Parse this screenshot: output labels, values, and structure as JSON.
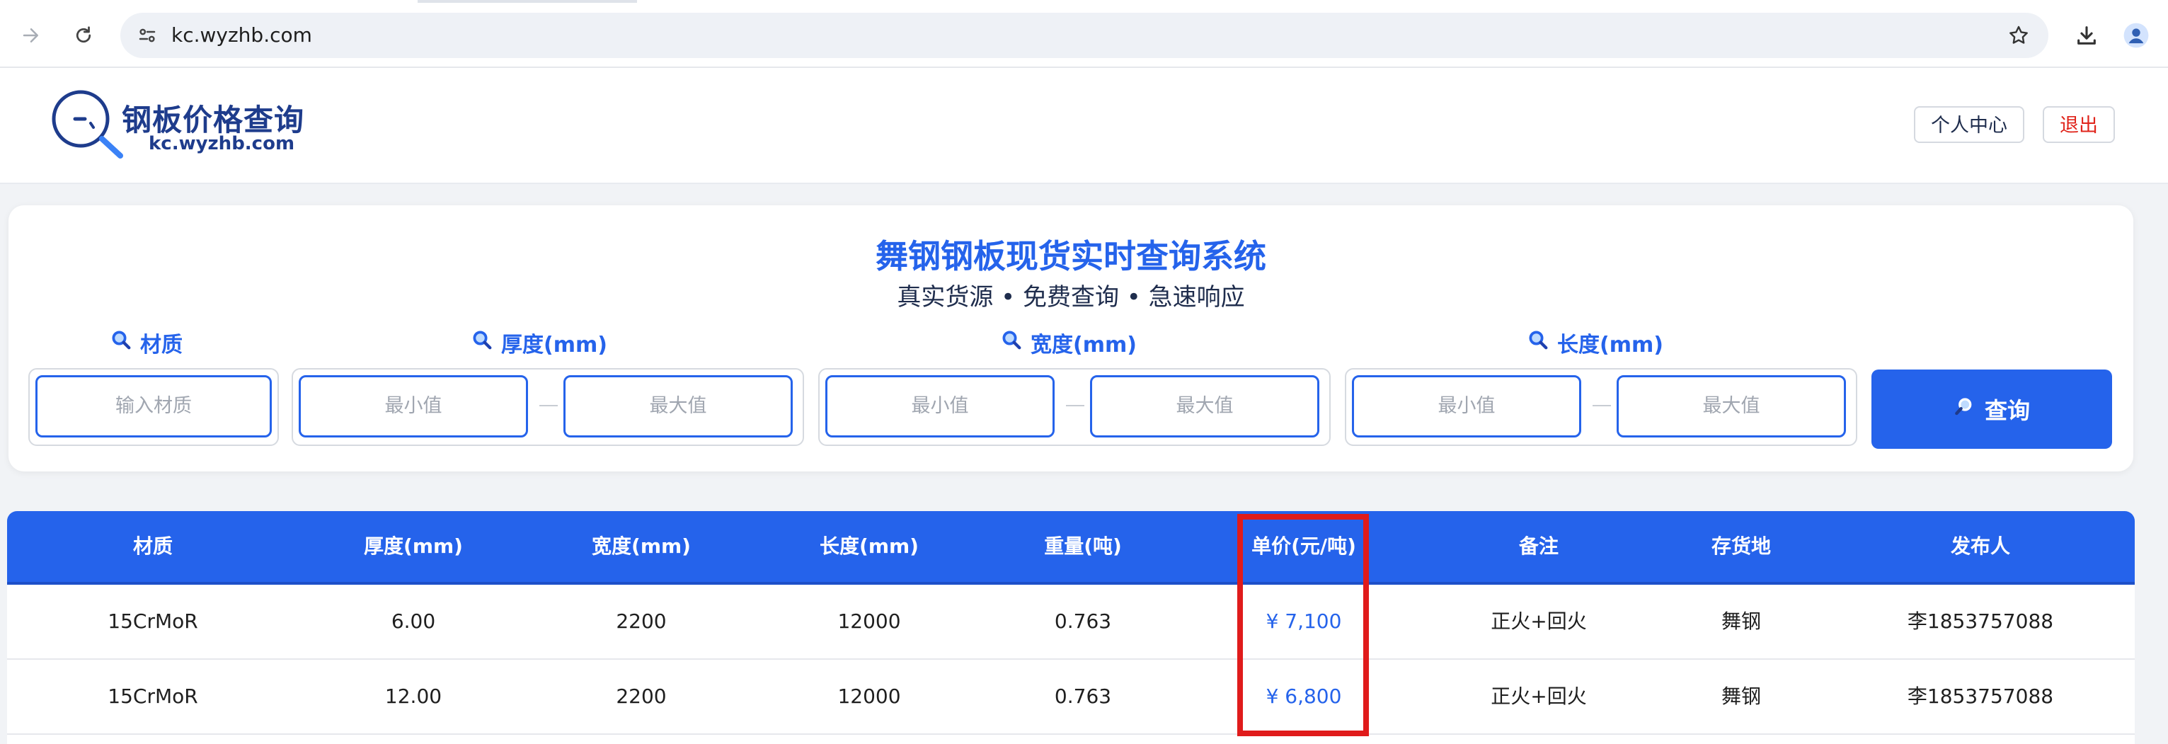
{
  "browser": {
    "url": "kc.wyzhb.com",
    "icons": [
      "forward-icon",
      "reload-icon",
      "site-settings-icon",
      "star-icon",
      "download-icon",
      "profile-icon"
    ]
  },
  "header": {
    "logo_title": "钢板价格查询",
    "logo_domain": "kc.wyzhb.com",
    "user_center_label": "个人中心",
    "logout_label": "退出"
  },
  "search": {
    "title": "舞钢钢板现货实时查询系统",
    "subtitle": "真实货源 • 免费查询 • 急速响应",
    "material_label": "材质",
    "material_placeholder": "输入材质",
    "thickness_label": "厚度(mm)",
    "width_label": "宽度(mm)",
    "length_label": "长度(mm)",
    "min_placeholder": "最小值",
    "max_placeholder": "最大值",
    "submit_label": "查询"
  },
  "table": {
    "columns": [
      "材质",
      "厚度(mm)",
      "宽度(mm)",
      "长度(mm)",
      "重量(吨)",
      "单价(元/吨)",
      "备注",
      "存货地",
      "发布人"
    ],
    "rows": [
      [
        "15CrMoR",
        "6.00",
        "2200",
        "12000",
        "0.763",
        "¥ 7,100",
        "正火+回火",
        "舞钢",
        "李1853757088"
      ],
      [
        "15CrMoR",
        "12.00",
        "2200",
        "12000",
        "0.763",
        "¥ 6,800",
        "正火+回火",
        "舞钢",
        "李1853757088"
      ]
    ]
  },
  "colors": {
    "accent": "#2563eb",
    "logo": "#1e3c8c",
    "logout": "#e0241b",
    "highlight": "#e01b1b"
  }
}
